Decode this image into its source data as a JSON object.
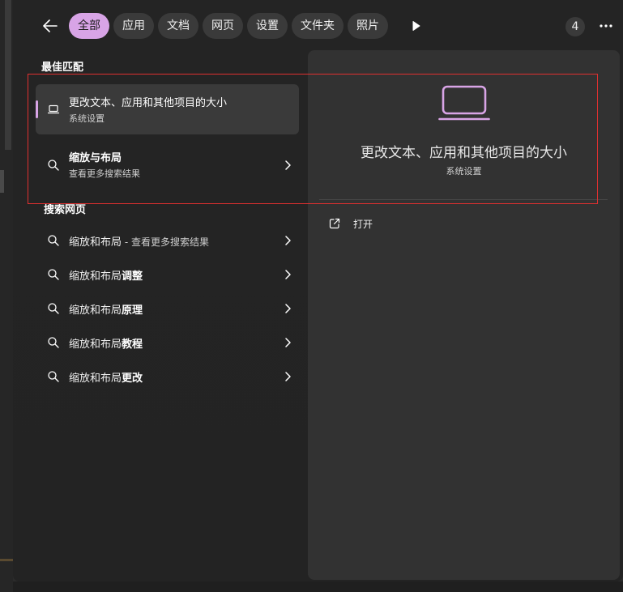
{
  "header": {
    "chips": [
      "全部",
      "应用",
      "文档",
      "网页",
      "设置",
      "文件夹",
      "照片"
    ],
    "active_chip": 0,
    "badge_count": "4"
  },
  "best_match": {
    "heading": "最佳匹配",
    "items": [
      {
        "title": "更改文本、应用和其他项目的大小",
        "subtitle": "系统设置"
      },
      {
        "title": "缩放与布局",
        "subtitle": "查看更多搜索结果"
      }
    ]
  },
  "web_search": {
    "heading": "搜索网页",
    "items": [
      {
        "prefix": "缩放和布局",
        "bold": "",
        "suffix": " - 查看更多搜索结果"
      },
      {
        "prefix": "缩放和布局",
        "bold": "调整",
        "suffix": ""
      },
      {
        "prefix": "缩放和布局",
        "bold": "原理",
        "suffix": ""
      },
      {
        "prefix": "缩放和布局",
        "bold": "教程",
        "suffix": ""
      },
      {
        "prefix": "缩放和布局",
        "bold": "更改",
        "suffix": ""
      }
    ]
  },
  "preview": {
    "title": "更改文本、应用和其他项目的大小",
    "subtitle": "系统设置",
    "actions": [
      {
        "label": "打开",
        "icon": "open-external-icon"
      }
    ]
  },
  "colors": {
    "accent": "#d8a4e6",
    "highlight": "#e03030"
  }
}
